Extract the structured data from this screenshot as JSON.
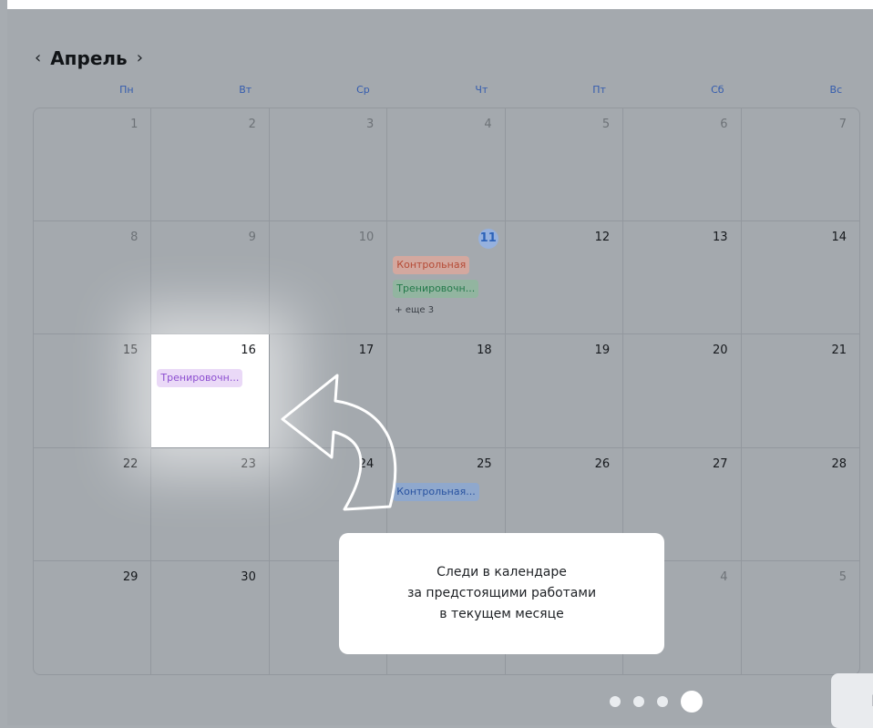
{
  "header": {
    "title": "Апрель",
    "prev_icon": "chevron-left-icon",
    "next_icon": "chevron-right-icon"
  },
  "weekdays": [
    "Пн",
    "Вт",
    "Ср",
    "Чт",
    "Пт",
    "Сб",
    "Вс"
  ],
  "days": [
    {
      "num": "1",
      "muted": true
    },
    {
      "num": "2",
      "muted": true
    },
    {
      "num": "3",
      "muted": true
    },
    {
      "num": "4",
      "muted": true
    },
    {
      "num": "5",
      "muted": true
    },
    {
      "num": "6",
      "muted": true
    },
    {
      "num": "7",
      "muted": true
    },
    {
      "num": "8",
      "muted": true
    },
    {
      "num": "9",
      "muted": true
    },
    {
      "num": "10",
      "muted": true
    },
    {
      "num": "11",
      "today": true,
      "events": [
        {
          "title": "Контрольная",
          "color": "red"
        },
        {
          "title": "Тренировочн...",
          "color": "green"
        }
      ],
      "more": "+ еще 3"
    },
    {
      "num": "12"
    },
    {
      "num": "13"
    },
    {
      "num": "14"
    },
    {
      "num": "15"
    },
    {
      "num": "16",
      "highlight": true,
      "events": [
        {
          "title": "Тренировочн...",
          "color": "purple"
        }
      ]
    },
    {
      "num": "17"
    },
    {
      "num": "18"
    },
    {
      "num": "19"
    },
    {
      "num": "20"
    },
    {
      "num": "21"
    },
    {
      "num": "22"
    },
    {
      "num": "23"
    },
    {
      "num": "24"
    },
    {
      "num": "25",
      "events": [
        {
          "title": "Контрольная...",
          "color": "blue"
        }
      ]
    },
    {
      "num": "26"
    },
    {
      "num": "27"
    },
    {
      "num": "28"
    },
    {
      "num": "29"
    },
    {
      "num": "30"
    },
    {
      "num": ""
    },
    {
      "num": ""
    },
    {
      "num": "",
      "muted": true
    },
    {
      "num": "4",
      "muted": true
    },
    {
      "num": "5",
      "muted": true
    }
  ],
  "tooltip": {
    "lines": [
      "Следи в календаре",
      "за предстоящими работами",
      "в текущем месяце"
    ]
  },
  "pagination": {
    "count": 4,
    "active": 3
  },
  "colors": {
    "accent": "#345cae",
    "today": "#2c62b8",
    "overlay": "#a4a9ae"
  }
}
